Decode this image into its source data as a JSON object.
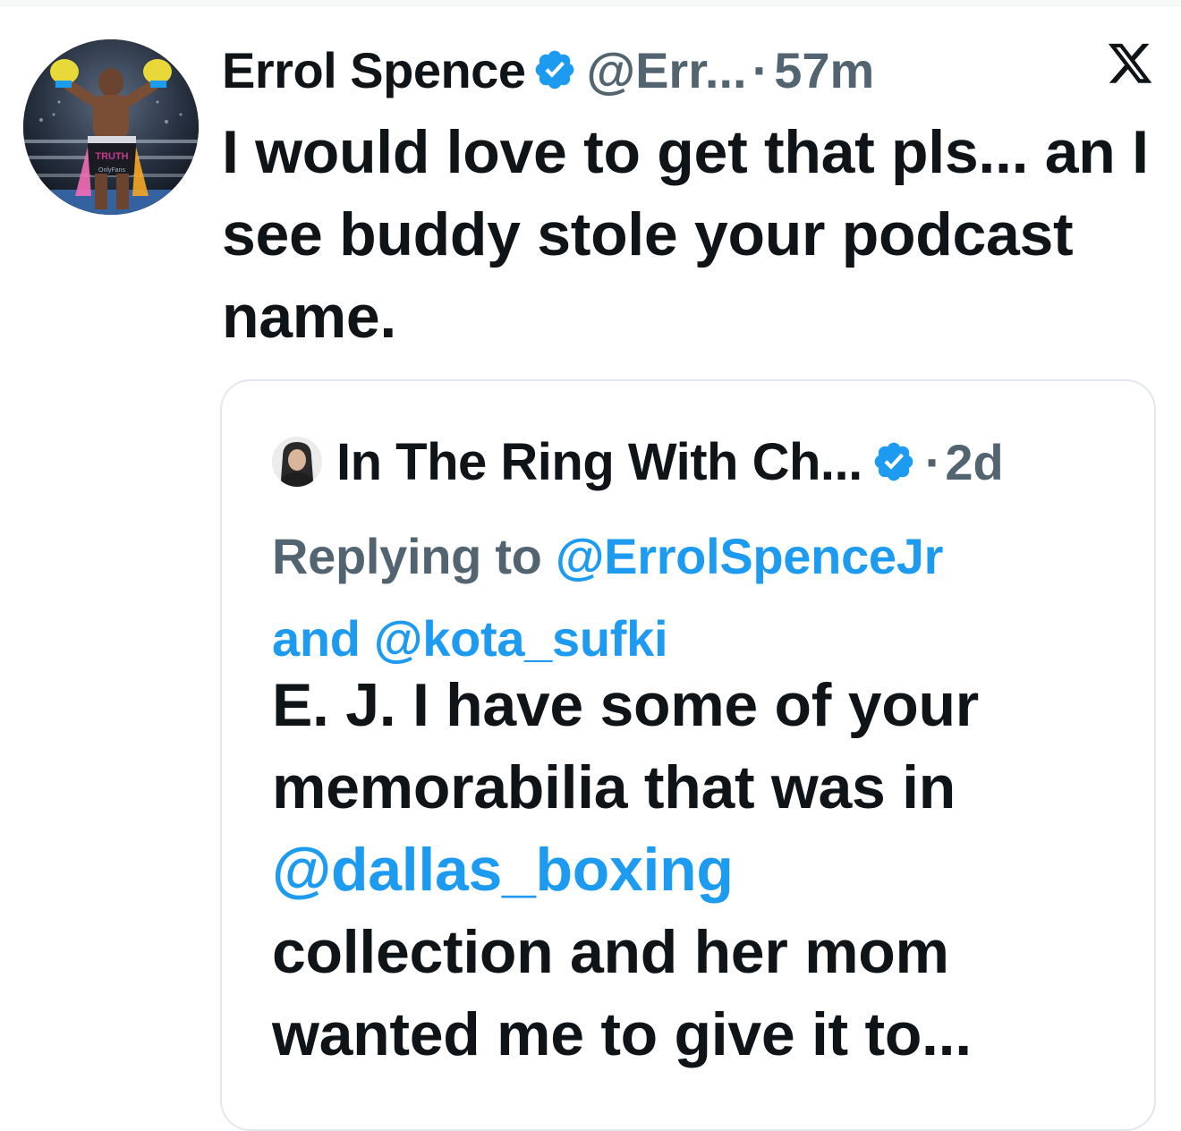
{
  "tweet": {
    "author_name": "Errol Spence",
    "author_handle": "@Err...",
    "separator": "·",
    "time": "57m",
    "text": "I would love to get that pls... an I see buddy stole your podcast name.",
    "avatar_caption": {
      "shorts_text": "TRUTH",
      "sponsor_text": "OnlyFans"
    }
  },
  "quoted_tweet": {
    "author_name": "In The Ring With Ch...",
    "separator": "·",
    "time": "2d",
    "replying_prefix": "Replying to ",
    "replying_mention_1": "@ErrolSpenceJr",
    "replying_and": "and ",
    "replying_mention_2": "@kota_sufki",
    "text_line_1": "E. J. I have some of your",
    "text_line_2": "memorabilia that was in",
    "text_mention": "@dallas_boxing",
    "text_line_4": "collection and her mom",
    "text_line_5": "wanted me to give it to..."
  },
  "icons": {
    "verified_badge": "verified-badge-icon",
    "x_logo": "x-logo-icon"
  },
  "colors": {
    "text": "#0f1419",
    "secondary": "#536471",
    "accent": "#1d9bf0",
    "border": "#e1e8ed"
  }
}
